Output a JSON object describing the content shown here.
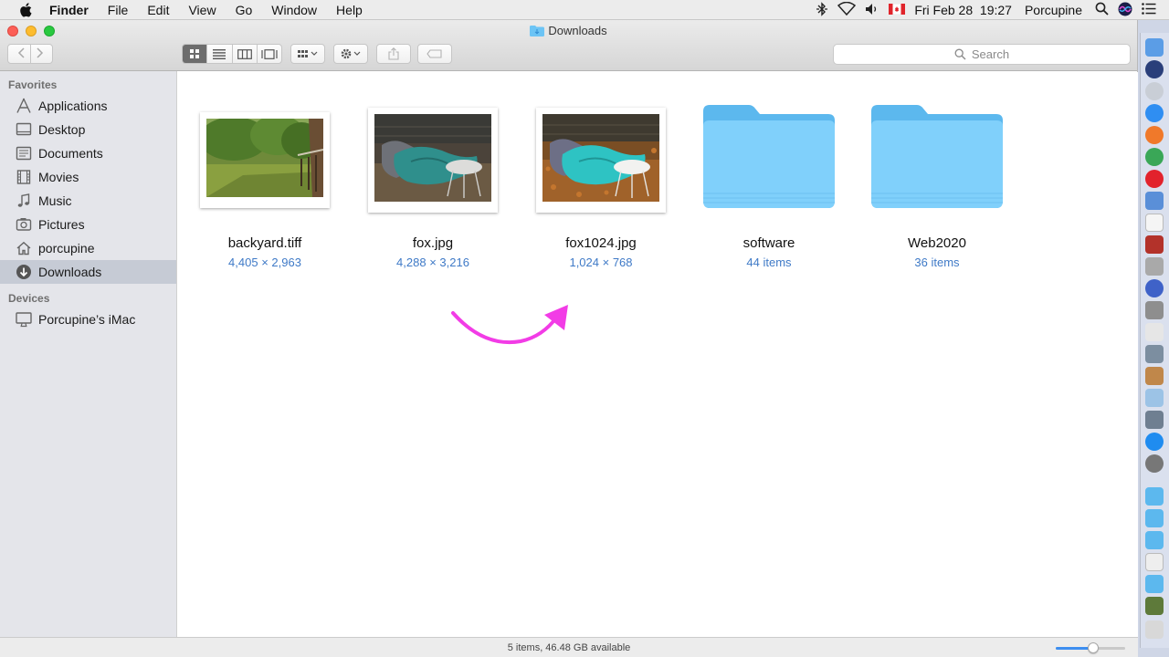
{
  "menubar": {
    "app_name": "Finder",
    "items": [
      "File",
      "Edit",
      "View",
      "Go",
      "Window",
      "Help"
    ],
    "datetime": "Fri Feb 28  19:27",
    "user": "Porcupine"
  },
  "window": {
    "title": "Downloads",
    "search_placeholder": "Search"
  },
  "sidebar": {
    "favorites_header": "Favorites",
    "favorites": [
      {
        "label": "Applications",
        "icon": "applications-icon"
      },
      {
        "label": "Desktop",
        "icon": "desktop-icon"
      },
      {
        "label": "Documents",
        "icon": "documents-icon"
      },
      {
        "label": "Movies",
        "icon": "movies-icon"
      },
      {
        "label": "Music",
        "icon": "music-icon"
      },
      {
        "label": "Pictures",
        "icon": "pictures-icon"
      },
      {
        "label": "porcupine",
        "icon": "home-icon"
      },
      {
        "label": "Downloads",
        "icon": "downloads-icon",
        "selected": true
      }
    ],
    "devices_header": "Devices",
    "devices": [
      {
        "label": "Porcupine’s iMac",
        "icon": "imac-icon"
      }
    ]
  },
  "files": [
    {
      "name": "backyard.tiff",
      "meta": "4,405 × 2,963",
      "kind": "image"
    },
    {
      "name": "fox.jpg",
      "meta": "4,288 × 3,216",
      "kind": "image"
    },
    {
      "name": "fox1024.jpg",
      "meta": "1,024 × 768",
      "kind": "image"
    },
    {
      "name": "software",
      "meta": "44 items",
      "kind": "folder"
    },
    {
      "name": "Web2020",
      "meta": "36 items",
      "kind": "folder"
    }
  ],
  "status": {
    "text": "5 items, 46.48 GB available",
    "icon_size_level": 0.55
  },
  "colors": {
    "accent": "#3f7ac7",
    "annotation_arrow": "#f23ce6",
    "folder": "#6cc4f5"
  }
}
